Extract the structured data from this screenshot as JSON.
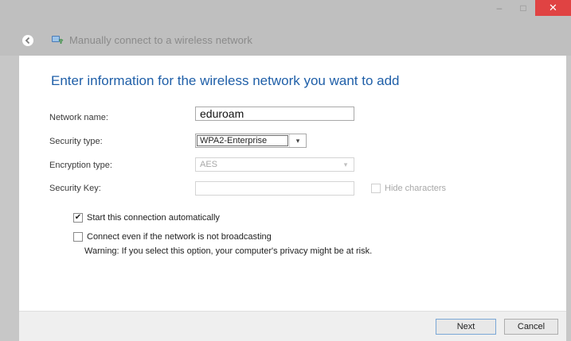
{
  "window": {
    "title": "Manually connect to a wireless network",
    "controls": {
      "minimize_label": "–",
      "maximize_label": "□",
      "close_label": "✕"
    }
  },
  "heading": "Enter information for the wireless network you want to add",
  "form": {
    "network_name": {
      "label": "Network name:",
      "value": "eduroam"
    },
    "security_type": {
      "label": "Security type:",
      "value": "WPA2-Enterprise"
    },
    "encryption_type": {
      "label": "Encryption type:",
      "value": "AES"
    },
    "security_key": {
      "label": "Security Key:",
      "value": "",
      "hide_characters_label": "Hide characters"
    }
  },
  "options": {
    "start_automatically": {
      "label": "Start this connection automatically",
      "checked": true
    },
    "connect_not_broadcasting": {
      "label": "Connect even if the network is not broadcasting",
      "checked": false
    },
    "warning": "Warning: If you select this option, your computer's privacy might be at risk."
  },
  "footer": {
    "next_label": "Next",
    "cancel_label": "Cancel"
  },
  "colors": {
    "heading": "#1f5fa8",
    "chrome": "#bfbfbf",
    "close_button": "#e04343"
  }
}
